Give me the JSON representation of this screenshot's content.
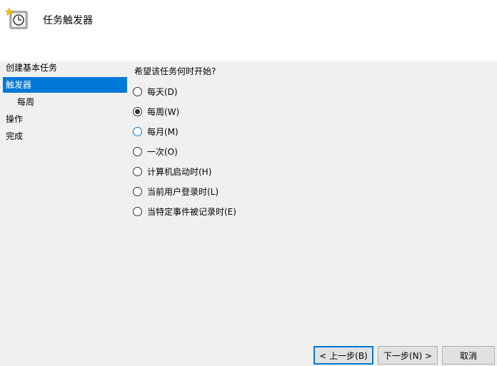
{
  "header": {
    "title": "任务触发器",
    "icon": "task-scheduler-icon"
  },
  "nav": {
    "items": [
      {
        "label": "创建基本任务",
        "selected": false,
        "sub": false
      },
      {
        "label": "触发器",
        "selected": true,
        "sub": false
      },
      {
        "label": "每周",
        "selected": false,
        "sub": true
      },
      {
        "label": "操作",
        "selected": false,
        "sub": false
      },
      {
        "label": "完成",
        "selected": false,
        "sub": false
      }
    ]
  },
  "content": {
    "question": "希望该任务何时开始?",
    "options": [
      {
        "label": "每天(D)",
        "checked": false
      },
      {
        "label": "每周(W)",
        "checked": true
      },
      {
        "label": "每月(M)",
        "checked": false
      },
      {
        "label": "一次(O)",
        "checked": false
      },
      {
        "label": "计算机启动时(H)",
        "checked": false
      },
      {
        "label": "当前用户登录时(L)",
        "checked": false
      },
      {
        "label": "当特定事件被记录时(E)",
        "checked": false
      }
    ]
  },
  "buttons": {
    "back": "< 上一步(B)",
    "next": "下一步(N) >",
    "cancel": "取消"
  },
  "colors": {
    "accent": "#0078d7",
    "panel": "#f0f0f0",
    "header": "#ffffff"
  }
}
